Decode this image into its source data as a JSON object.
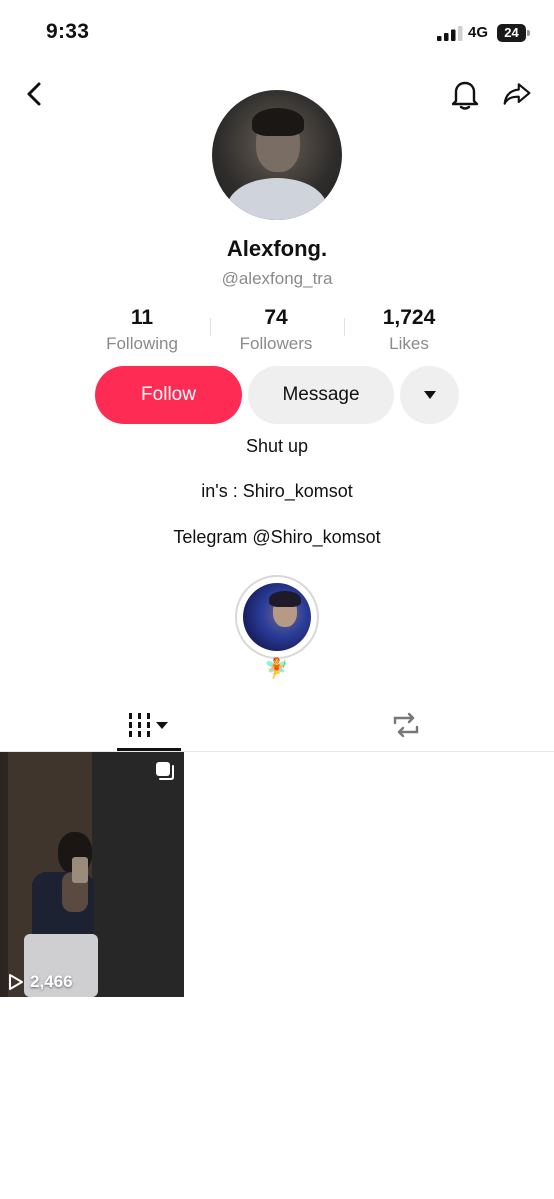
{
  "status_bar": {
    "time": "9:33",
    "network": "4G",
    "battery": "24"
  },
  "profile": {
    "display_name": "Alexfong.",
    "username": "@alexfong_tra",
    "stats": [
      {
        "value": "11",
        "label": "Following"
      },
      {
        "value": "74",
        "label": "Followers"
      },
      {
        "value": "1,724",
        "label": "Likes"
      }
    ],
    "actions": {
      "follow": "Follow",
      "message": "Message"
    },
    "bio": [
      "Shut up",
      "in's : Shiro_komsot",
      "Telegram @Shiro_komsot"
    ],
    "highlight_emoji": "🧚"
  },
  "videos": [
    {
      "views": "2,466"
    }
  ],
  "icons": {
    "back": "chevron-left-icon",
    "bell": "bell-icon",
    "share": "share-icon",
    "more": "caret-down-icon",
    "grid": "videos-grid-icon",
    "repost": "repost-icon",
    "multi": "multi-image-icon",
    "play": "play-icon"
  },
  "colors": {
    "accent": "#fe2c55",
    "secondary_button": "#efefef",
    "muted_text": "#8a8a8a"
  }
}
